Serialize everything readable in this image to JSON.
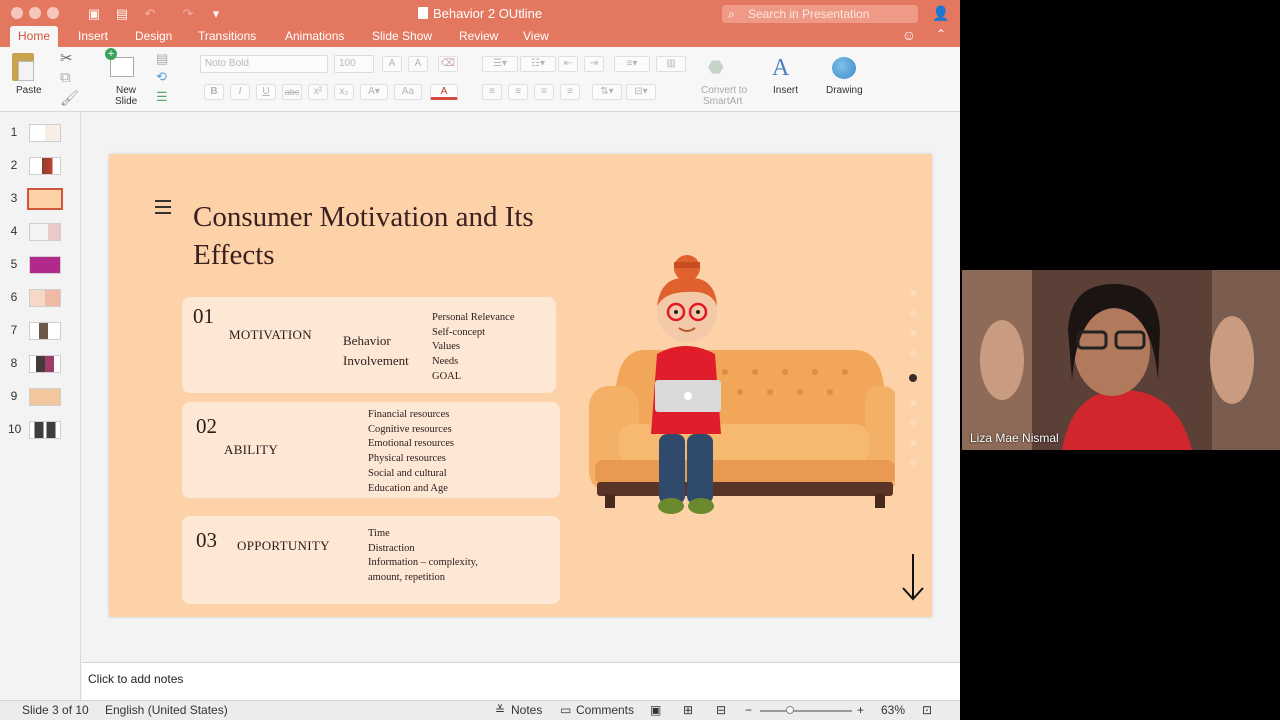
{
  "window": {
    "title": "Behavior 2 OUtline",
    "search_placeholder": "Search in Presentation"
  },
  "tabs": [
    "Home",
    "Insert",
    "Design",
    "Transitions",
    "Animations",
    "Slide Show",
    "Review",
    "View"
  ],
  "ribbon": {
    "paste": "Paste",
    "new_slide_line1": "New",
    "new_slide_line2": "Slide",
    "font_name": "Noto Bold",
    "font_size": "100",
    "convert_smartart_line1": "Convert to",
    "convert_smartart_line2": "SmartArt",
    "insert": "Insert",
    "drawing": "Drawing",
    "bold": "B",
    "italic": "I",
    "underline": "U",
    "strike": "abc"
  },
  "thumbnails": {
    "numbers": [
      "1",
      "2",
      "3",
      "4",
      "5",
      "6",
      "7",
      "8",
      "9",
      "10"
    ],
    "selected_index": 3
  },
  "slide": {
    "title": "Consumer Motivation and Its Effects",
    "cards": [
      {
        "number": "01",
        "name": "MOTIVATION",
        "sub_line1": "Behavior",
        "sub_line2": "Involvement",
        "items": [
          "Personal Relevance",
          "Self-concept",
          "Values",
          "Needs",
          "GOAL"
        ]
      },
      {
        "number": "02",
        "name": "ABILITY",
        "items": [
          "Financial resources",
          "Cognitive resources",
          "Emotional resources",
          "Physical resources",
          "Social and cultural",
          "Education and Age"
        ]
      },
      {
        "number": "03",
        "name": "OPPORTUNITY",
        "items": [
          "Time",
          "Distraction",
          "Information – complexity,",
          "amount, repetition"
        ]
      }
    ]
  },
  "notes_placeholder": "Click to add notes",
  "status": {
    "slide_info": "Slide 3 of 10",
    "language": "English (United States)",
    "notes": "Notes",
    "comments": "Comments",
    "zoom": "63%"
  },
  "video": {
    "participant_name": "Liza Mae Nismal"
  },
  "colors": {
    "ribbon_accent": "#e4775f",
    "slide_background": "#fdd2a9",
    "card_background": "#fde8d5",
    "selected_thumb_border": "#d0563b"
  }
}
